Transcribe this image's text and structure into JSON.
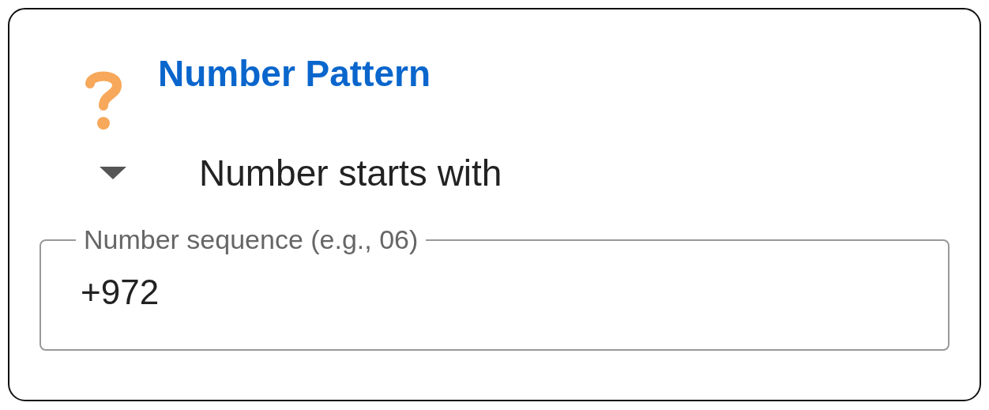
{
  "title": "Number Pattern",
  "dropdown": {
    "label": "Number starts with"
  },
  "field": {
    "label": "Number sequence (e.g., 06)",
    "value": "+972"
  }
}
